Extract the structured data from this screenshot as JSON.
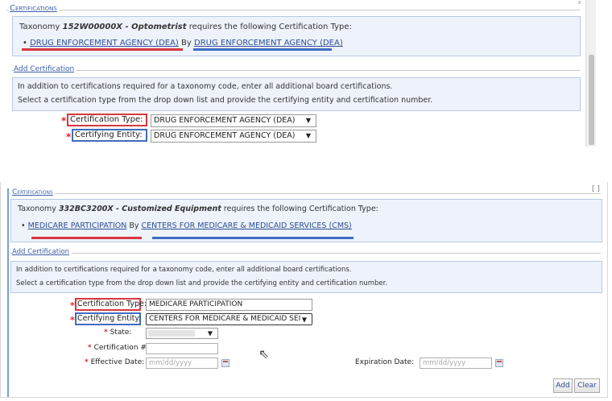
{
  "shot1": {
    "section_title": "Certifications",
    "corner_mark": "ᶻ",
    "taxonomy": {
      "prefix": "Taxonomy ",
      "code": "152W00000X",
      "name": " - Optometrist",
      "suffix": " requires the following Certification Type:",
      "cert_type": "DRUG ENFORCEMENT AGENCY (DEA)",
      "by": " By ",
      "entity": "DRUG ENFORCEMENT AGENCY (DEA)"
    },
    "add_title": "Add Certification",
    "info_line1": "In addition to certifications required for a taxonomy code, enter all additional board certifications.",
    "info_line2": "Select a certification type from the drop down list and provide the certifying entity and certification number.",
    "cert_type_label": "Certification Type:",
    "cert_type_value": "DRUG ENFORCEMENT AGENCY (DEA)",
    "entity_label": "Certifying Entity:",
    "entity_value": "DRUG ENFORCEMENT AGENCY (DEA)"
  },
  "shot2": {
    "section_title": "Certifications",
    "corner_mark": "[ ]",
    "taxonomy": {
      "prefix": "Taxonomy ",
      "code": "332BC3200X",
      "name": " - Customized Equipment",
      "suffix": " requires the following Certification Type:",
      "cert_type": "MEDICARE PARTICIPATION",
      "by": " By ",
      "entity": "CENTERS FOR MEDICARE & MEDICAID SERVICES (CMS)"
    },
    "add_title": "Add Certification",
    "info_line1": "In addition to certifications required for a taxonomy code, enter all additional board certifications.",
    "info_line2": "Select a certification type from the drop down list and provide the certifying entity and certification number.",
    "cert_type_label": "Certification Type:",
    "cert_type_value": "MEDICARE PARTICIPATION",
    "entity_label": "Certifying Entity:",
    "entity_value": "CENTERS FOR MEDICARE & MEDICAID SEI",
    "state_label": "State:",
    "cert_num_label": "Certification #:",
    "effective_label": "Effective Date:",
    "effective_placeholder": "mm/dd/yyyy",
    "expiration_label": "Expiration Date:",
    "expiration_placeholder": "mm/dd/yyyy",
    "add_button": "Add",
    "clear_button": "Clear"
  },
  "glyphs": {
    "required": "*",
    "caret": "▼"
  },
  "colors": {
    "highlight_red": "#d8373d",
    "highlight_blue": "#3e6cc0",
    "info_bg": "#eef3fb",
    "link": "#2e4d96"
  }
}
